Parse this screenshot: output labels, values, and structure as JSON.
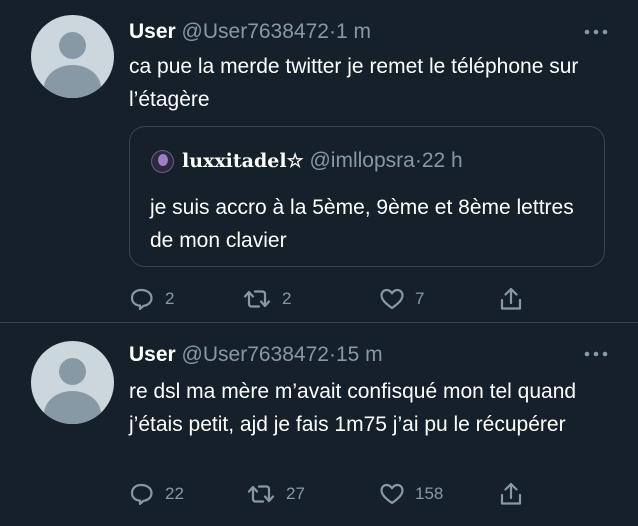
{
  "tweets": [
    {
      "name": "User",
      "handle": "@User7638472",
      "separator": "·",
      "time": "1 m",
      "text": "ca pue la merde twitter je remet le téléphone sur l’étagère",
      "quote": {
        "name": "luxxitadel☆",
        "handle": "@imllopsra",
        "separator": "·",
        "time": "22 h",
        "text": "je suis accro à la 5ème, 9ème et 8ème lettres de mon clavier"
      },
      "actions": {
        "replies": "2",
        "retweets": "2",
        "likes": "7"
      }
    },
    {
      "name": "User",
      "handle": "@User7638472",
      "separator": "·",
      "time": "15 m",
      "text": "re dsl ma mère m’avait confisqué mon tel quand j’étais petit, ajd je fais 1m75 j’ai pu le récupérer",
      "actions": {
        "replies": "22",
        "retweets": "27",
        "likes": "158"
      }
    }
  ],
  "icons": {
    "avatar": "default-profile-avatar",
    "more": "more-dots-icon",
    "reply": "reply-bubble-icon",
    "retweet": "retweet-arrows-icon",
    "like": "heart-outline-icon",
    "share": "share-upload-icon"
  },
  "colors": {
    "background": "#15202b",
    "text": "#ffffff",
    "secondary": "#8899a6",
    "border": "#38444d",
    "avatar_bg": "#ccd6dd",
    "avatar_fg": "#8899a6"
  }
}
